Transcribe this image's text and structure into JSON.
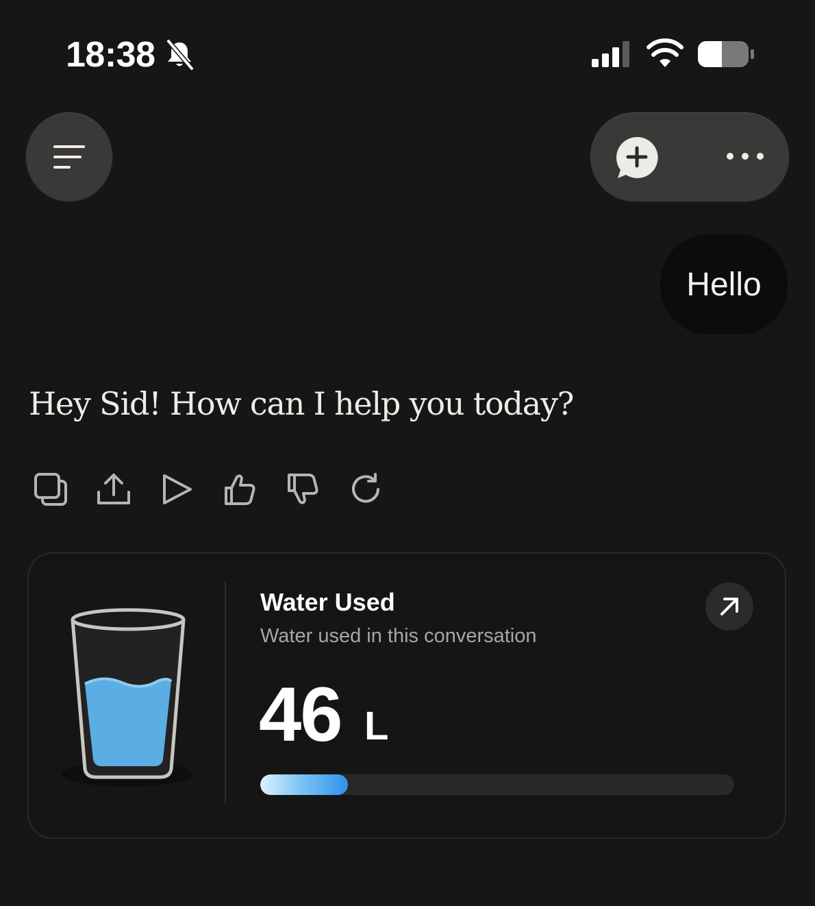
{
  "status_bar": {
    "time": "18:38",
    "icons": [
      "bell-slash-icon",
      "signal-icon",
      "wifi-icon",
      "battery-icon"
    ]
  },
  "header": {
    "menu_icon": "menu-icon",
    "new_chat_icon": "new-chat-icon",
    "more_icon": "more-icon"
  },
  "conversation": {
    "user_message": "Hello",
    "assistant_message": "Hey Sid! How can I help you today?",
    "actions": [
      "copy-icon",
      "share-icon",
      "play-icon",
      "thumbs-up-icon",
      "thumbs-down-icon",
      "retry-icon"
    ]
  },
  "water_card": {
    "title": "Water Used",
    "subtitle": "Water used in this conversation",
    "value": "46",
    "unit": "L",
    "progress_fraction": 0.185,
    "open_icon": "arrow-up-right-icon",
    "glass_icon": "water-glass-icon"
  },
  "colors": {
    "background": "#171616",
    "button_bg": "#3a3938",
    "water_blue": "#5aaee3",
    "progress_start": "#dff1ff",
    "progress_end": "#2e93ea"
  }
}
